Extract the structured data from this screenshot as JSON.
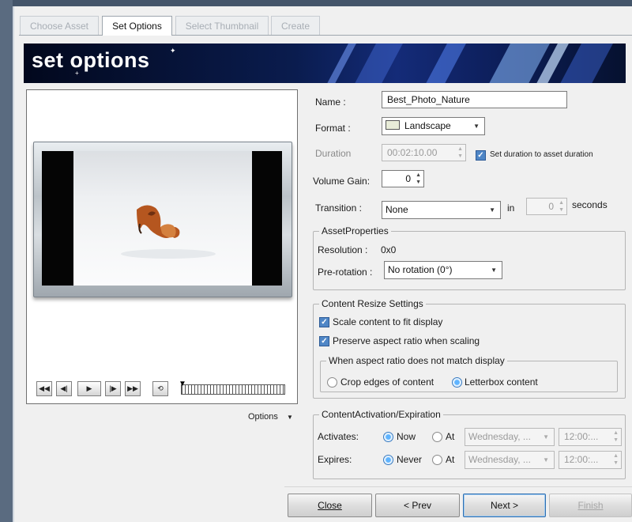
{
  "tabs": [
    {
      "label": "Choose Asset",
      "active": false
    },
    {
      "label": "Set Options",
      "active": true
    },
    {
      "label": "Select Thumbnail",
      "active": false
    },
    {
      "label": "Create",
      "active": false
    }
  ],
  "banner": {
    "title": "set options"
  },
  "preview": {
    "controls": [
      "skip-to-start",
      "step-back",
      "play",
      "step-forward",
      "skip-to-end",
      "loop"
    ],
    "options_label": "Options"
  },
  "form": {
    "name": {
      "label": "Name :",
      "value": "Best_Photo_Nature"
    },
    "format": {
      "label": "Format :",
      "value": "Landscape"
    },
    "duration": {
      "label": "Duration",
      "value": "00:02:10.00",
      "checkbox_label": "Set duration to asset duration",
      "checked": true
    },
    "volume": {
      "label": "Volume Gain:",
      "value": "0"
    },
    "transition": {
      "label": "Transition :",
      "value": "None",
      "in_label": "in",
      "seconds_value": "0",
      "seconds_label": "seconds"
    }
  },
  "asset_properties": {
    "legend": "AssetProperties",
    "resolution_label": "Resolution :",
    "resolution_value": "0x0",
    "prerotation_label": "Pre-rotation :",
    "prerotation_value": "No rotation (0°)"
  },
  "resize": {
    "legend": "Content Resize Settings",
    "scale_label": "Scale content to fit display",
    "scale_checked": true,
    "preserve_label": "Preserve aspect ratio when scaling",
    "preserve_checked": true,
    "mismatch_legend": "When aspect ratio does not match display",
    "crop_label": "Crop edges of content",
    "letterbox_label": "Letterbox content",
    "selected": "letterbox"
  },
  "activation": {
    "legend": "ContentActivation/Expiration",
    "activates_label": "Activates:",
    "now_label": "Now",
    "at_label": "At",
    "activates_date": "Wednesday, ...",
    "activates_time": "12:00:...",
    "expires_label": "Expires:",
    "never_label": "Never",
    "expires_at_label": "At",
    "expires_date": "Wednesday, ...",
    "expires_time": "12:00:..."
  },
  "buttons": {
    "close": "Close",
    "prev": "< Prev",
    "next": "Next >",
    "finish": "Finish"
  },
  "colors": {
    "banner": "#0a1c4e",
    "accent": "#4f86c6",
    "fox": "#c0642a"
  }
}
